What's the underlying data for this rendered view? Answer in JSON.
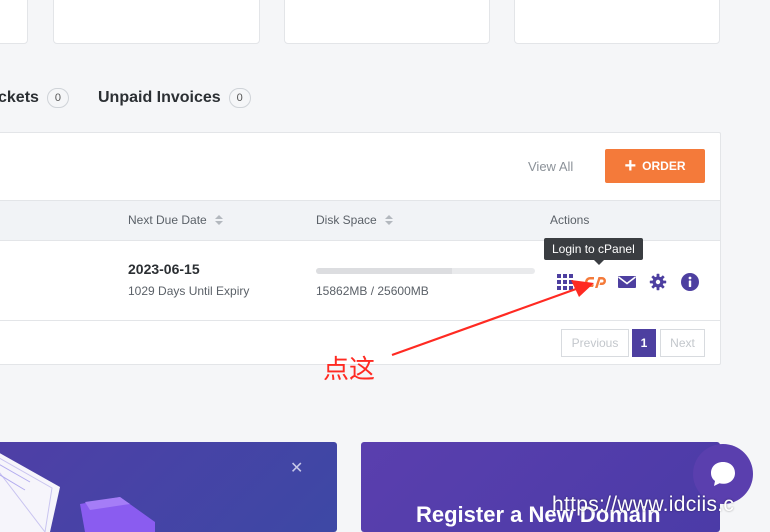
{
  "tabs": [
    {
      "label": "ckets",
      "count": "0"
    },
    {
      "label": "Unpaid Invoices",
      "count": "0"
    }
  ],
  "panel": {
    "view_all": "View All",
    "order_label": "ORDER",
    "columns": {
      "next_due_date": "Next Due Date",
      "disk_space": "Disk Space",
      "actions": "Actions"
    },
    "row": {
      "due_date": "2023-06-15",
      "days_until": "1029 Days Until Expiry",
      "disk_usage_text": "15862MB / 25600MB",
      "disk_used_fraction": 0.62
    },
    "tooltip": "Login to cPanel",
    "actions": [
      "grid-icon",
      "cpanel-icon",
      "mail-icon",
      "gear-icon",
      "info-icon"
    ],
    "pagination": {
      "previous": "Previous",
      "current": "1",
      "next": "Next"
    }
  },
  "annotation": "点这",
  "promo": {
    "right_title": "Register a New Domain"
  },
  "watermark": "https://www.idciis.c",
  "colors": {
    "accent": "#f47a3a",
    "brand": "#4d3fa0",
    "annotation": "#ff2a22"
  }
}
